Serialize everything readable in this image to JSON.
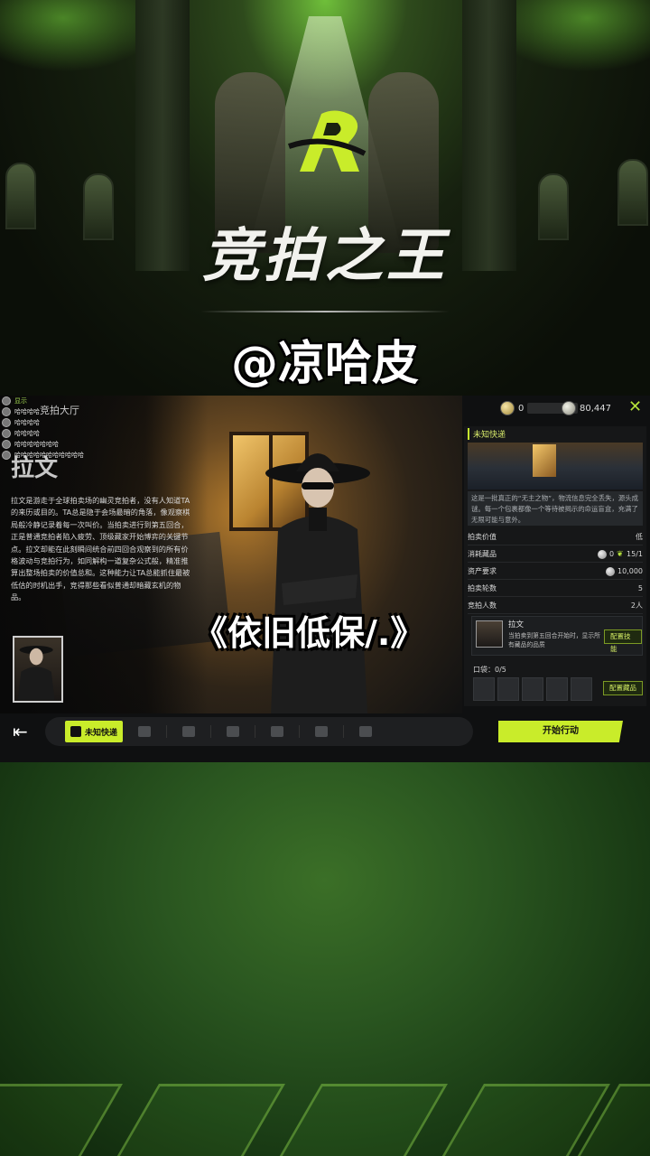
{
  "banner": {
    "game_title": "竞拍之王",
    "handle": "@凉哈皮"
  },
  "game": {
    "lobby_title": "竞拍大厅",
    "currency": [
      {
        "icon": "gold-coin-icon",
        "value": "0"
      },
      {
        "icon": "silver-coin-icon",
        "value": "80,447"
      }
    ],
    "chat": [
      {
        "name": "显示",
        "text": ""
      },
      {
        "name": "",
        "text": "哈哈哈哈"
      },
      {
        "name": "",
        "text": "哈哈哈哈"
      },
      {
        "name": "",
        "text": "哈哈哈哈"
      },
      {
        "name": "",
        "text": "哈哈哈哈哈哈哈"
      },
      {
        "name": "",
        "text": "哈哈哈哈哈哈哈哈哈哈哈"
      }
    ],
    "character": {
      "name": "拉文",
      "description": "拉文是游走于全球拍卖场的幽灵竞拍者，没有人知道TA的来历或目的。TA总是隐于会场最暗的角落，像观察棋局般冷静记录着每一次叫价。当拍卖进行到第五回合，正是普通竞拍者陷入疲劳、顶级藏家开始博弈的关键节点。拉文却能在此刻瞬间统合前四回合观察到的所有价格波动与竞拍行为，如同解构一道复杂公式般，精准推算出整场拍卖的价值总和。这种能力让TA总能抓住最被低估的时机出手，竞得那些看似普通却暗藏玄机的物品。"
    },
    "overlay_caption": "《依旧低保/.》",
    "panel": {
      "header": "未知快递",
      "note": "这是一批真正的“无主之物”，物流信息完全丢失，源头成谜。每一个包裹都像一个等待被揭示的命运盲盒，充满了无限可能与意外。",
      "rows": [
        {
          "label": "拍卖价值",
          "value": "低"
        },
        {
          "label": "消耗藏品",
          "value_a": "0",
          "value_b": "15/1"
        },
        {
          "label": "资产要求",
          "value": "10,000"
        },
        {
          "label": "拍卖轮数",
          "value": "5"
        },
        {
          "label": "竞拍人数",
          "value": "2人"
        }
      ],
      "skill": {
        "name": "拉文",
        "description": "当拍卖到第五回合开始时，显示所有藏品的品质",
        "button": "配置技能"
      },
      "pocket_label": "口袋：0/5",
      "pocket_button": "配置藏品"
    },
    "bottom": {
      "active_tab": "未知快递",
      "tab_icons": [
        "crate-plus-icon",
        "crate-icon",
        "chest-icon",
        "case-icon",
        "box-edit-icon",
        "package-icon"
      ],
      "start_button": "开始行动"
    }
  },
  "colors": {
    "accent": "#c9ec2a",
    "green_bg": "#2a5620"
  }
}
